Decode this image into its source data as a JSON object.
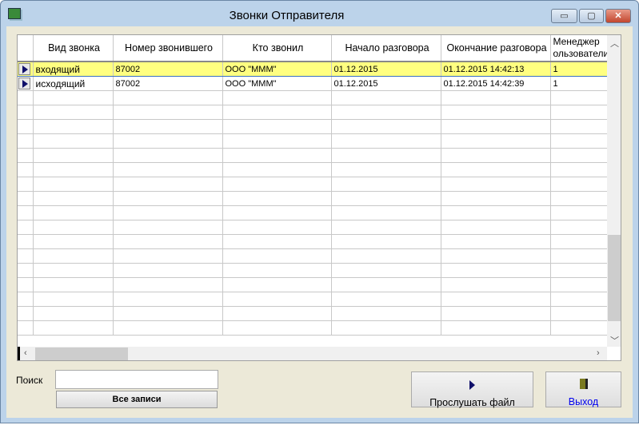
{
  "window": {
    "title": "Звонки Отправителя",
    "minimize": "▭",
    "maximize": "▢",
    "close": "✕"
  },
  "grid": {
    "columns": [
      "Вид звонка",
      "Номер звонившего",
      "Кто звонил",
      "Начало разговора",
      "Окончание разговора",
      "Менеджер\nользователи"
    ],
    "rows": [
      [
        "входящий",
        "87002",
        "ООО \"МММ\"",
        "01.12.2015",
        "01.12.2015 14:42:13",
        "1"
      ],
      [
        "исходящий",
        "87002",
        "ООО \"МММ\"",
        "01.12.2015",
        "01.12.2015 14:42:39",
        "1"
      ]
    ],
    "selected_row": 0
  },
  "search": {
    "label": "Поиск",
    "value": "",
    "all_records": "Все записи"
  },
  "buttons": {
    "play": "Прослушать файл",
    "exit": "Выход"
  }
}
